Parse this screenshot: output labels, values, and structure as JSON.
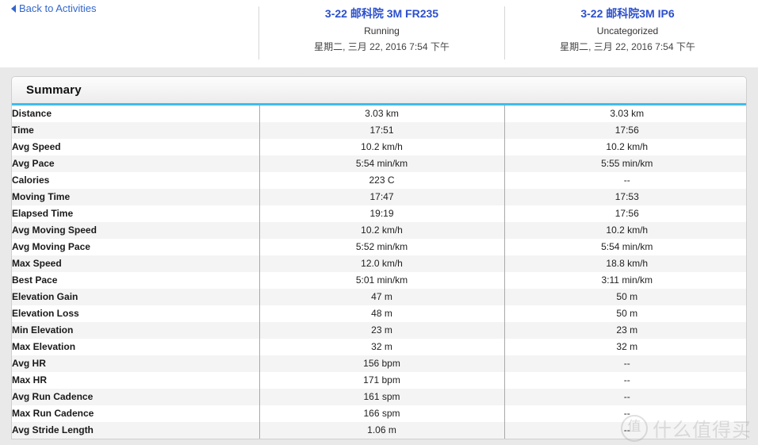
{
  "nav": {
    "back_label": "Back to Activities",
    "back_icon": "triangle-left-icon"
  },
  "activities": [
    {
      "title": "3-22 邮科院 3M FR235",
      "type": "Running",
      "date": "星期二, 三月 22, 2016 7:54 下午"
    },
    {
      "title": "3-22 邮科院3M IP6",
      "type": "Uncategorized",
      "date": "星期二, 三月 22, 2016 7:54 下午"
    }
  ],
  "panel": {
    "title": "Summary",
    "accent_color": "#3fbcef",
    "background_color": "#e9e9e9",
    "link_color": "#3366cc",
    "activity_title_color": "#2b4fcd"
  },
  "table": {
    "rows": [
      {
        "label": "Distance",
        "col1": "3.03 km",
        "col2": "3.03 km"
      },
      {
        "label": "Time",
        "col1": "17:51",
        "col2": "17:56"
      },
      {
        "label": "Avg Speed",
        "col1": "10.2 km/h",
        "col2": "10.2 km/h"
      },
      {
        "label": "Avg Pace",
        "col1": "5:54 min/km",
        "col2": "5:55 min/km"
      },
      {
        "label": "Calories",
        "col1": "223 C",
        "col2": "--"
      },
      {
        "label": "Moving Time",
        "col1": "17:47",
        "col2": "17:53"
      },
      {
        "label": "Elapsed Time",
        "col1": "19:19",
        "col2": "17:56"
      },
      {
        "label": "Avg Moving Speed",
        "col1": "10.2 km/h",
        "col2": "10.2 km/h"
      },
      {
        "label": "Avg Moving Pace",
        "col1": "5:52 min/km",
        "col2": "5:54 min/km"
      },
      {
        "label": "Max Speed",
        "col1": "12.0 km/h",
        "col2": "18.8 km/h"
      },
      {
        "label": "Best Pace",
        "col1": "5:01 min/km",
        "col2": "3:11 min/km"
      },
      {
        "label": "Elevation Gain",
        "col1": "47 m",
        "col2": "50 m"
      },
      {
        "label": "Elevation Loss",
        "col1": "48 m",
        "col2": "50 m"
      },
      {
        "label": "Min Elevation",
        "col1": "23 m",
        "col2": "23 m"
      },
      {
        "label": "Max Elevation",
        "col1": "32 m",
        "col2": "32 m"
      },
      {
        "label": "Avg HR",
        "col1": "156 bpm",
        "col2": "--"
      },
      {
        "label": "Max HR",
        "col1": "171 bpm",
        "col2": "--"
      },
      {
        "label": "Avg Run Cadence",
        "col1": "161 spm",
        "col2": "--"
      },
      {
        "label": "Max Run Cadence",
        "col1": "166 spm",
        "col2": "--"
      },
      {
        "label": "Avg Stride Length",
        "col1": "1.06 m",
        "col2": "--"
      }
    ]
  },
  "watermark": {
    "mark": "值",
    "text": "什么值得买"
  }
}
